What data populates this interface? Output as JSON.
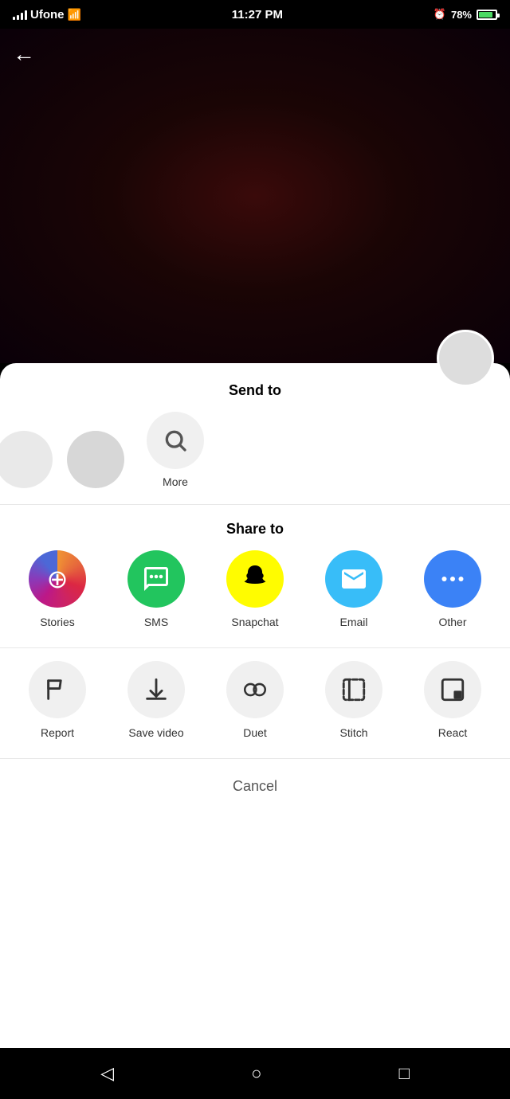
{
  "statusBar": {
    "carrier": "Ufone",
    "time": "11:27 PM",
    "battery": "78%"
  },
  "header": {
    "backLabel": "←"
  },
  "sheet": {
    "sendToTitle": "Send to",
    "shareToTitle": "Share to",
    "moreLabel": "More",
    "cancelLabel": "Cancel"
  },
  "shareTo": [
    {
      "id": "stories",
      "label": "Stories",
      "type": "stories"
    },
    {
      "id": "sms",
      "label": "SMS",
      "type": "sms"
    },
    {
      "id": "snapchat",
      "label": "Snapchat",
      "type": "snapchat"
    },
    {
      "id": "email",
      "label": "Email",
      "type": "email"
    },
    {
      "id": "other",
      "label": "Other",
      "type": "other"
    }
  ],
  "actions": [
    {
      "id": "report",
      "label": "Report",
      "icon": "flag"
    },
    {
      "id": "save-video",
      "label": "Save video",
      "icon": "download"
    },
    {
      "id": "duet",
      "label": "Duet",
      "icon": "duet"
    },
    {
      "id": "stitch",
      "label": "Stitch",
      "icon": "stitch"
    },
    {
      "id": "react",
      "label": "React",
      "icon": "react"
    }
  ],
  "nav": {
    "back": "◁",
    "home": "○",
    "recents": "□"
  }
}
